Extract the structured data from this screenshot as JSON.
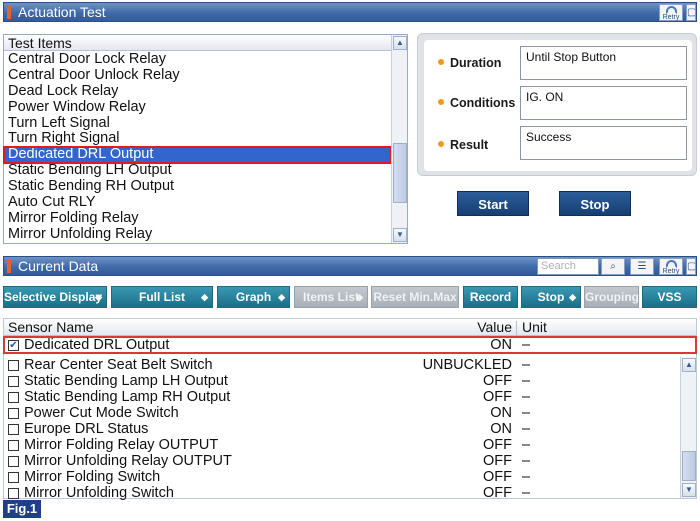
{
  "actuation_panel": {
    "title": "Actuation Test",
    "retry_label": "Retry"
  },
  "test_items": {
    "header": "Test Items",
    "items": [
      "Central Door Lock Relay",
      "Central Door Unlock Relay",
      "Dead Lock Relay",
      "Power Window Relay",
      "Turn Left Signal",
      "Turn Right Signal",
      "Dedicated DRL Output",
      "Static Bending LH Output",
      "Static Bending RH Output",
      "Auto Cut RLY",
      "Mirror Folding Relay",
      "Mirror Unfolding Relay"
    ],
    "selected_index": 6
  },
  "info": {
    "duration_label": "Duration",
    "duration_value": "Until Stop Button",
    "conditions_label": "Conditions",
    "conditions_value": "IG. ON",
    "result_label": "Result",
    "result_value": "Success"
  },
  "buttons": {
    "start": "Start",
    "stop": "Stop"
  },
  "current_data": {
    "title": "Current Data",
    "search_placeholder": "Search",
    "retry_label": "Retry"
  },
  "toolbar": {
    "selective_display": "Selective Display",
    "full_list": "Full List",
    "graph": "Graph",
    "items_list": "Items List",
    "reset_min_max": "Reset Min.Max",
    "record": "Record",
    "stop": "Stop",
    "grouping": "Grouping",
    "vss": "VSS"
  },
  "table": {
    "col_name": "Sensor Name",
    "col_value": "Value",
    "col_unit": "Unit",
    "rows": [
      {
        "name": "Dedicated DRL Output",
        "value": "ON",
        "unit": "–",
        "checked": true
      },
      {
        "name": "Rear Center Seat Belt Switch",
        "value": "UNBUCKLED",
        "unit": "–",
        "checked": false
      },
      {
        "name": "Static Bending Lamp LH Output",
        "value": "OFF",
        "unit": "–",
        "checked": false
      },
      {
        "name": "Static Bending Lamp RH Output",
        "value": "OFF",
        "unit": "–",
        "checked": false
      },
      {
        "name": "Power Cut Mode Switch",
        "value": "ON",
        "unit": "–",
        "checked": false
      },
      {
        "name": "Europe DRL Status",
        "value": "ON",
        "unit": "–",
        "checked": false
      },
      {
        "name": "Mirror Folding Relay OUTPUT",
        "value": "OFF",
        "unit": "–",
        "checked": false
      },
      {
        "name": "Mirror Unfolding Relay OUTPUT",
        "value": "OFF",
        "unit": "–",
        "checked": false
      },
      {
        "name": "Mirror Folding Switch",
        "value": "OFF",
        "unit": "–",
        "checked": false
      },
      {
        "name": "Mirror Unfolding Switch",
        "value": "OFF",
        "unit": "–",
        "checked": false
      }
    ]
  },
  "figure_label": "Fig.1"
}
